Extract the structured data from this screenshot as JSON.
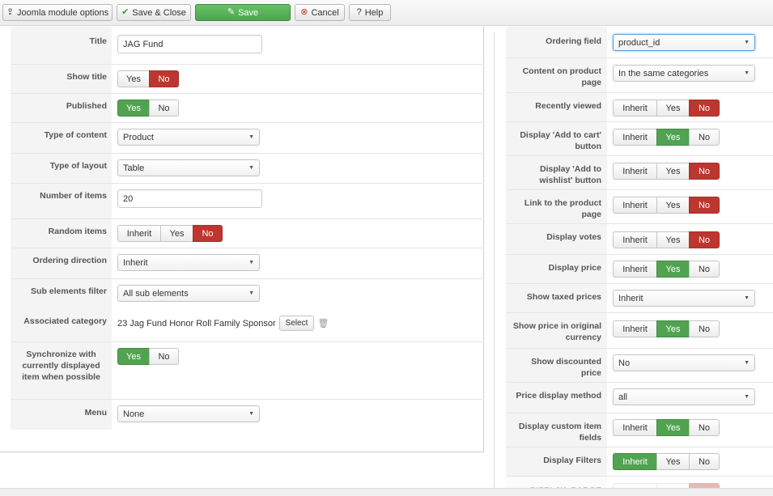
{
  "toolbar": {
    "module_options": "Joomla module options",
    "save_close": "Save & Close",
    "save": "Save",
    "cancel": "Cancel",
    "help": "Help"
  },
  "left": {
    "title_label": "Title",
    "title_value": "JAG Fund",
    "show_title_label": "Show title",
    "published_label": "Published",
    "type_content_label": "Type of content",
    "type_content_value": "Product",
    "type_layout_label": "Type of layout",
    "type_layout_value": "Table",
    "num_items_label": "Number of items",
    "num_items_value": "20",
    "random_label": "Random items",
    "ordering_dir_label": "Ordering direction",
    "ordering_dir_value": "Inherit",
    "sub_filter_label": "Sub elements filter",
    "sub_filter_value": "All sub elements",
    "assoc_cat_label": "Associated category",
    "assoc_cat_value": "23 Jag Fund Honor Roll Family Sponsor",
    "select_btn": "Select",
    "sync_label": "Synchronize with currently displayed item when possible",
    "menu_label": "Menu",
    "menu_value": "None"
  },
  "right": {
    "ordering_field_label": "Ordering field",
    "ordering_field_value": "product_id",
    "content_product_label": "Content on product page",
    "content_product_value": "In the same categories",
    "recently_viewed_label": "Recently viewed",
    "add_cart_label": "Display 'Add to cart' button",
    "add_wishlist_label": "Display 'Add to wishlist' button",
    "link_product_label": "Link to the product page",
    "votes_label": "Display votes",
    "price_label": "Display price",
    "taxed_label": "Show taxed prices",
    "taxed_value": "Inherit",
    "orig_currency_label": "Show price in original currency",
    "discounted_label": "Show discounted price",
    "discounted_value": "No",
    "price_method_label": "Price display method",
    "price_method_value": "all",
    "custom_fields_label": "Display custom item fields",
    "filters_label": "Display Filters",
    "display_badge_label": "DISPLAY_BADGE"
  },
  "opt": {
    "yes": "Yes",
    "no": "No",
    "inherit": "Inherit"
  },
  "colors": {
    "active_red": "#bd362f",
    "active_green": "#51a351",
    "focus_blue": "#5b9bd5"
  }
}
